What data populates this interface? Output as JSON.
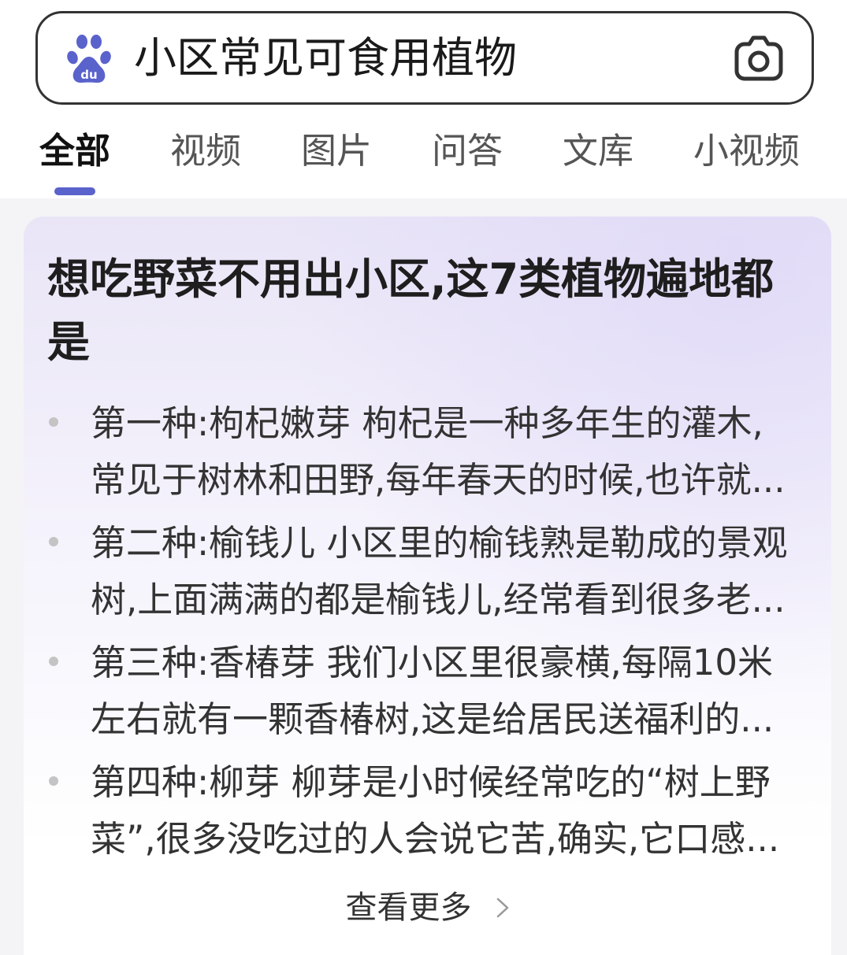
{
  "colors": {
    "accent": "#5a62cc",
    "logo": "#5a62cc"
  },
  "search": {
    "logo_icon": "baidu-paw-logo",
    "logo_text": "du",
    "query": "小区常见可食用植物",
    "camera_icon": "camera-icon"
  },
  "tabs": [
    {
      "label": "全部",
      "active": true
    },
    {
      "label": "视频",
      "active": false
    },
    {
      "label": "图片",
      "active": false
    },
    {
      "label": "问答",
      "active": false
    },
    {
      "label": "文库",
      "active": false
    },
    {
      "label": "小视频",
      "active": false
    }
  ],
  "result_card": {
    "title_lines": [
      "想吃野菜不用出小区,这7类植物遍地都",
      "是"
    ],
    "items": [
      {
        "lines": [
          "第一种:枸杞嫩芽 枸杞是一种多年生的灌木,",
          "常见于树林和田野,每年春天的时候,也许就..."
        ]
      },
      {
        "lines": [
          "第二种:榆钱儿 小区里的榆钱熟是勒成的景观",
          "树,上面满满的都是榆钱儿,经常看到很多老..."
        ]
      },
      {
        "lines": [
          "第三种:香椿芽 我们小区里很豪横,每隔10米",
          "左右就有一颗香椿树,这是给居民送福利的..."
        ]
      },
      {
        "lines": [
          "第四种:柳芽 柳芽是小时候经常吃的“树上野",
          "菜”,很多没吃过的人会说它苦,确实,它口感..."
        ]
      }
    ],
    "more_label": "查看更多",
    "more_icon": "chevron-right-icon"
  }
}
